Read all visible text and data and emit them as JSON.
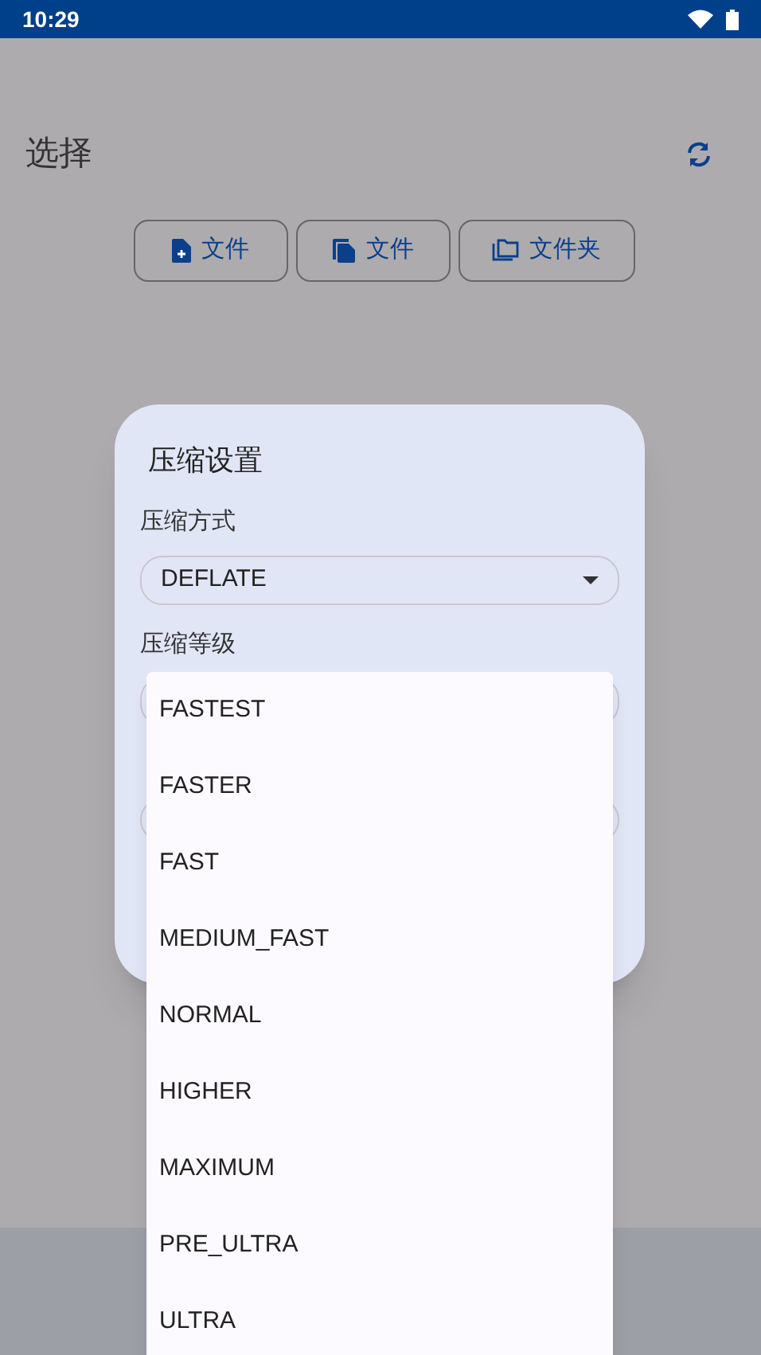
{
  "status_bar": {
    "time": "10:29"
  },
  "header": {
    "title": "选择"
  },
  "buttons": [
    {
      "kind": "file-add",
      "label": "文件"
    },
    {
      "kind": "files",
      "label": "文件"
    },
    {
      "kind": "folder",
      "label": "文件夹"
    }
  ],
  "dialog": {
    "title": "压缩设置",
    "fields": [
      {
        "label": "压缩方式",
        "value": "DEFLATE"
      },
      {
        "label": "压缩等级"
      }
    ]
  },
  "menu": {
    "items": [
      "FASTEST",
      "FASTER",
      "FAST",
      "MEDIUM_FAST",
      "NORMAL",
      "HIGHER",
      "MAXIMUM",
      "PRE_ULTRA",
      "ULTRA"
    ]
  }
}
